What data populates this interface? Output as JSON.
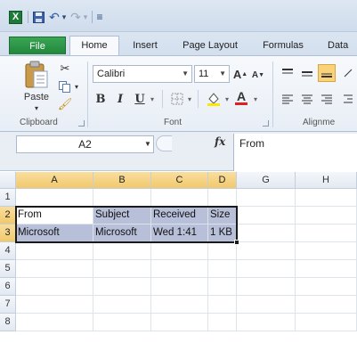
{
  "quick_access": {
    "excel_logo": "X",
    "undo_label": "↶",
    "redo_label": "↷",
    "dropdown_label": "▾",
    "customize_label": "≡"
  },
  "tabs": [
    {
      "label": "File"
    },
    {
      "label": "Home"
    },
    {
      "label": "Insert"
    },
    {
      "label": "Page Layout"
    },
    {
      "label": "Formulas"
    },
    {
      "label": "Data"
    }
  ],
  "ribbon": {
    "clipboard": {
      "paste_label": "Paste",
      "group_label": "Clipboard"
    },
    "font": {
      "font_name": "Calibri",
      "font_size": "11",
      "grow_label": "A",
      "shrink_label": "A",
      "bold": "B",
      "italic": "I",
      "underline": "U",
      "font_color_label": "A",
      "group_label": "Font"
    },
    "alignment": {
      "group_label": "Alignme"
    }
  },
  "formula_bar": {
    "name_box": "A2",
    "fx_label": "fx",
    "value": "From"
  },
  "grid": {
    "columns": [
      "A",
      "B",
      "C",
      "D",
      "G",
      "H"
    ],
    "rows": [
      "1",
      "2",
      "3",
      "4",
      "5",
      "6",
      "7",
      "8"
    ],
    "cells": {
      "A2": "From",
      "B2": "Subject",
      "C2": "Received",
      "D2": "Size",
      "A3": "Microsoft",
      "B3": "Microsoft",
      "C3": "Wed 1:41",
      "D3": "1 KB"
    }
  },
  "colors": {
    "file_tab": "#21863b",
    "selection_highlight": "#b7bfd9",
    "header_selected": "#f1c96a"
  }
}
